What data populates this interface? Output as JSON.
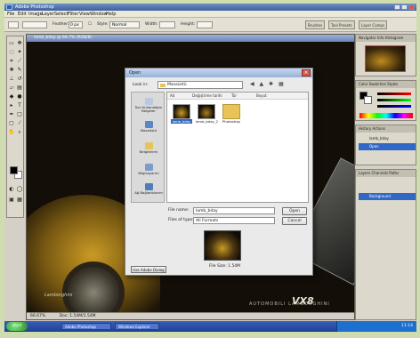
{
  "app": {
    "title": "Adobe Photoshop",
    "menus": [
      "File",
      "Edit",
      "Image",
      "Layer",
      "Select",
      "Filter",
      "View",
      "Window",
      "Help"
    ]
  },
  "options_bar": {
    "feather_label": "Feather:",
    "feather_value": "0 px",
    "style_label": "Style:",
    "style_value": "Normal",
    "width_label": "Width:",
    "height_label": "Height:",
    "palette_tabs": [
      "Brushes",
      "Tool Presets",
      "Layer Comps"
    ]
  },
  "document": {
    "tab_title": "lamb_bday @ 66.7% (RGB/8)",
    "zoom_status": "66.67%",
    "doc_status": "Doc: 1.54M/1.54M",
    "brand_left": "Lamborghini",
    "brand_line": "AUTOMOBILI LAMBORGHINI",
    "model": "VX8"
  },
  "palettes": {
    "navigator_tabs": "Navigator  Info  Histogram",
    "color_tabs": "Color  Swatches  Styles",
    "history_tabs": "History  Actions",
    "history_items": [
      "lamb_bday",
      "Open"
    ],
    "layers_tabs": "Layers  Channels  Paths",
    "layers_items": [
      "Background"
    ]
  },
  "dialog": {
    "title": "Open",
    "look_in_label": "Look in:",
    "look_in_value": "Masaüstü",
    "columns": [
      "Ad",
      "Değiştirme tarihi",
      "Tür",
      "Boyut"
    ],
    "places": [
      "Son Kullandığım Belgeler",
      "Masaüstü",
      "Belgelerim",
      "Bilgisayarım",
      "Ağ Bağlantılarım"
    ],
    "files": [
      {
        "name": "lamb_bday",
        "selected": true
      },
      {
        "name": "lamb_bday_2",
        "selected": false
      },
      {
        "name": "Photoshop",
        "selected": false
      }
    ],
    "file_name_label": "File name:",
    "file_name_value": "lamb_bday",
    "file_type_label": "Files of type:",
    "file_type_value": "All Formats",
    "open_button": "Open",
    "cancel_button": "Cancel",
    "use_adobe_dialog": "Use Adobe Dialog",
    "file_size": "File Size: 1.54M"
  },
  "taskbar": {
    "start": "start",
    "tasks": [
      "Adobe Photoshop",
      "Windows Explorer"
    ],
    "clock": "11:14"
  }
}
